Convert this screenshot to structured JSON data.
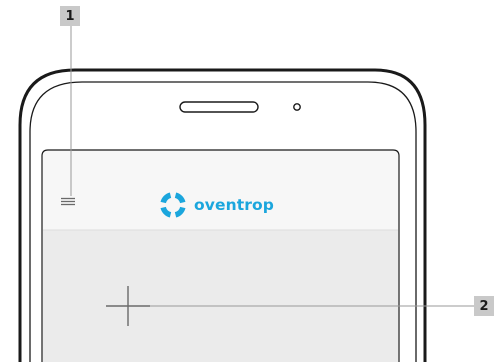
{
  "callouts": [
    {
      "label": "1"
    },
    {
      "label": "2"
    }
  ],
  "app": {
    "brand_name": "oventrop",
    "brand_color": "#1ba6dd",
    "menu_icon": "hamburger-menu-icon",
    "add_icon": "plus-icon"
  },
  "colors": {
    "phone_frame": "#1a1a1a",
    "header_bg": "#f7f7f7",
    "content_bg": "#ebebeb",
    "callout_badge_bg": "#c9c9c9"
  }
}
